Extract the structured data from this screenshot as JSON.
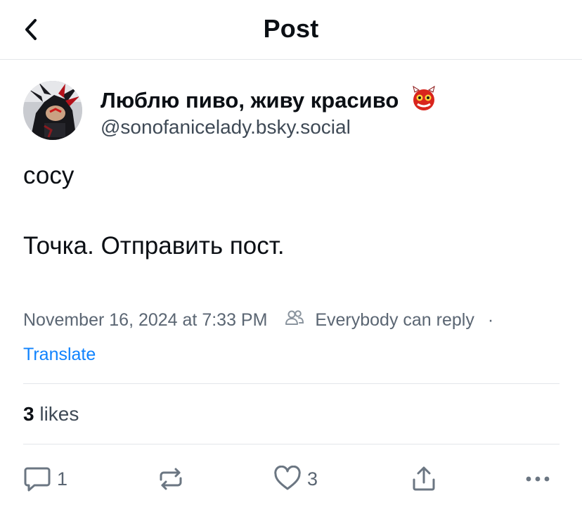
{
  "header": {
    "title": "Post"
  },
  "post": {
    "author": {
      "display_name": "Люблю пиво, живу красиво",
      "handle": "@sonofanicelady.bsky.social",
      "avatar_icon": "avatar-shadow-hedgehog",
      "name_emoji": "devil-emoji-icon"
    },
    "text": {
      "line1": "сосу",
      "line2": "Точка. Отправить пост."
    },
    "timestamp": "November 16, 2024 at 7:33 PM",
    "reply_setting": "Everybody can reply",
    "separator": "·",
    "translate_label": "Translate",
    "likes": {
      "count": "3",
      "label": "likes"
    }
  },
  "actions": {
    "reply_count": "1",
    "like_count": "3"
  },
  "colors": {
    "text": "#0b0f14",
    "muted": "#5b6673",
    "link": "#1083fe",
    "divider": "#e3e6ea"
  }
}
